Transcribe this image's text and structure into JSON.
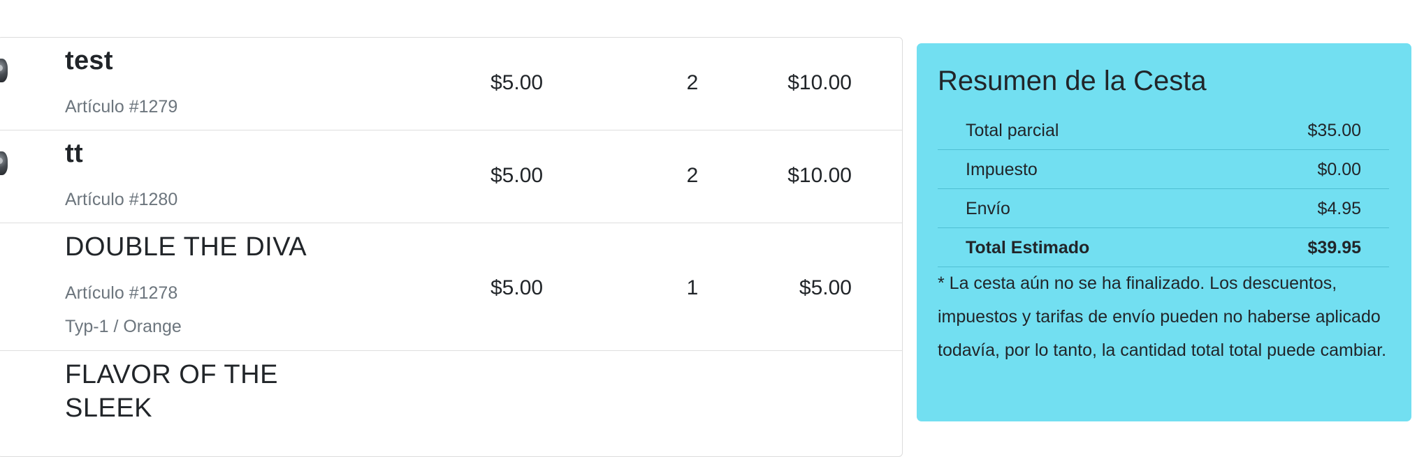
{
  "cart": {
    "items": [
      {
        "name": "test",
        "sku": "Artículo #1279",
        "variant": "",
        "price": "$5.00",
        "qty": "2",
        "total": "$10.00"
      },
      {
        "name": "tt",
        "sku": "Artículo #1280",
        "variant": "",
        "price": "$5.00",
        "qty": "2",
        "total": "$10.00"
      },
      {
        "name": "DOUBLE THE DIVA",
        "sku": "Artículo #1278",
        "variant": "Typ-1 / Orange",
        "price": "$5.00",
        "qty": "1",
        "total": "$5.00"
      },
      {
        "name_line1": "FLAVOR OF THE",
        "name_line2": "SLEEK"
      }
    ]
  },
  "summary": {
    "title": "Resumen de la Cesta",
    "rows": [
      {
        "label": "Total parcial",
        "value": "$35.00"
      },
      {
        "label": "Impuesto",
        "value": "$0.00"
      },
      {
        "label": "Envío",
        "value": "$4.95"
      },
      {
        "label": "Total Estimado",
        "value": "$39.95"
      }
    ],
    "note": "* La cesta aún no se ha finalizado. Los descuentos, impuestos y tarifas de envío pueden no haberse aplicado todavía, por lo tanto, la cantidad total total puede cambiar."
  },
  "colors": {
    "summary_bg": "#72dff1",
    "muted_text": "#6c757d",
    "text": "#212529"
  }
}
